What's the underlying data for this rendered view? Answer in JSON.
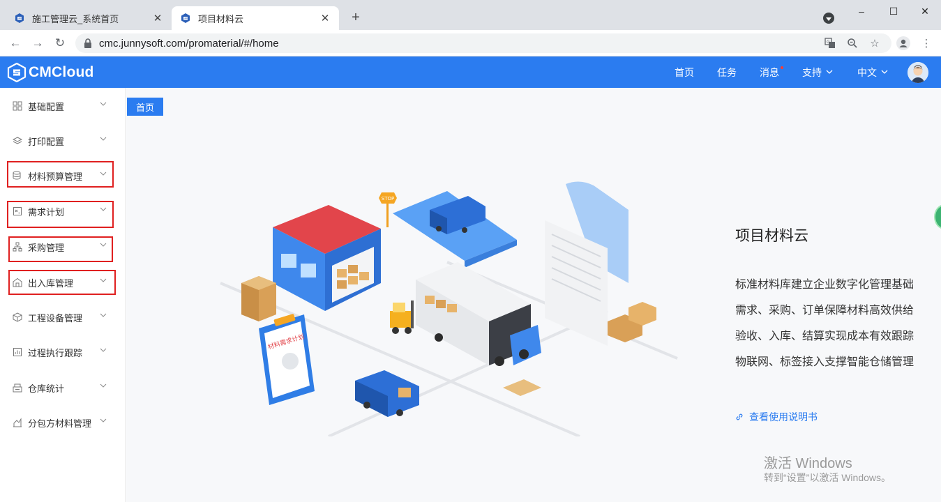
{
  "browser": {
    "tabs": [
      {
        "title": "施工管理云_系统首页",
        "active": false
      },
      {
        "title": "项目材料云",
        "active": true
      }
    ],
    "new_tab_label": "+",
    "window_controls": {
      "minimize": "–",
      "maximize": "☐",
      "close": "✕"
    },
    "url": "cmc.junnysoft.com/promaterial/#/home"
  },
  "app": {
    "brand": "CMCloud",
    "brand_color": "#2b7cf0",
    "nav": {
      "home": "首页",
      "tasks": "任务",
      "messages": "消息",
      "support": "支持",
      "language": "中文"
    }
  },
  "sidebar": {
    "items": [
      {
        "label": "基础配置",
        "icon": "grid-icon",
        "highlighted": false
      },
      {
        "label": "打印配置",
        "icon": "layers-icon",
        "highlighted": false
      },
      {
        "label": "材料预算管理",
        "icon": "database-icon",
        "highlighted": true
      },
      {
        "label": "需求计划",
        "icon": "document-icon",
        "highlighted": true
      },
      {
        "label": "采购管理",
        "icon": "org-chart-icon",
        "highlighted": true
      },
      {
        "label": "出入库管理",
        "icon": "warehouse-icon",
        "highlighted": true
      },
      {
        "label": "工程设备管理",
        "icon": "cube-icon",
        "highlighted": false
      },
      {
        "label": "过程执行跟踪",
        "icon": "report-icon",
        "highlighted": false
      },
      {
        "label": "仓库统计",
        "icon": "stack-icon",
        "highlighted": false
      },
      {
        "label": "分包方材料管理",
        "icon": "chart-icon",
        "highlighted": false
      }
    ]
  },
  "main": {
    "breadcrumb": "首页",
    "illustration": {
      "stop_sign": "STOP",
      "clipboard_title": "材料需求计划"
    },
    "intro": {
      "title": "项目材料云",
      "lines": [
        "标准材料库建立企业数字化管理基础",
        "需求、采购、订单保障材料高效供给",
        "验收、入库、结算实现成本有效跟踪",
        "物联网、标签接入支撑智能仓储管理"
      ],
      "manual_link": "查看使用说明书"
    }
  },
  "watermark": {
    "line1": "激活 Windows",
    "line2": "转到“设置”以激活 Windows。"
  }
}
